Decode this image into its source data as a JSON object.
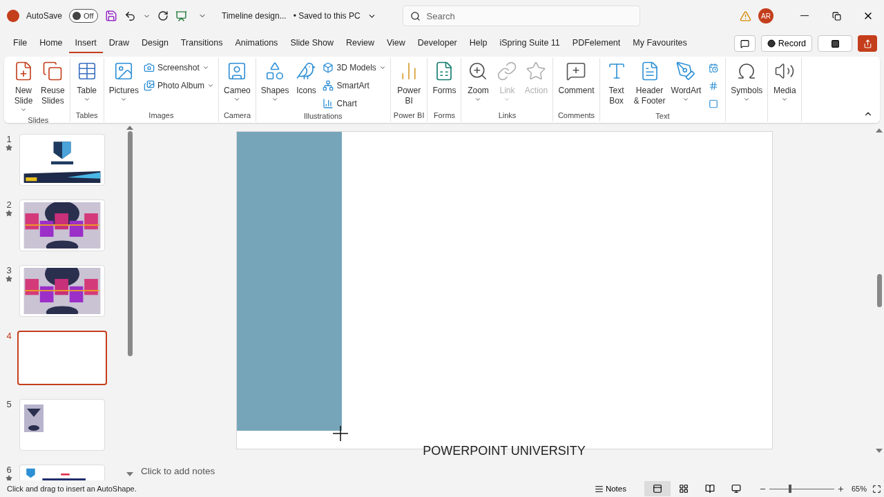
{
  "title_bar": {
    "autosave_label": "AutoSave",
    "autosave": {
      "label": "Off",
      "on": false
    },
    "document_title": "Timeline design...",
    "save_status": "• Saved to this PC",
    "search": {
      "placeholder": "Search"
    },
    "avatar": "AR"
  },
  "menu_tabs": [
    {
      "label": "File",
      "selected": false
    },
    {
      "label": "Home",
      "selected": false
    },
    {
      "label": "Insert",
      "selected": true
    },
    {
      "label": "Draw",
      "selected": false
    },
    {
      "label": "Design",
      "selected": false
    },
    {
      "label": "Transitions",
      "selected": false
    },
    {
      "label": "Animations",
      "selected": false
    },
    {
      "label": "Slide Show",
      "selected": false
    },
    {
      "label": "Review",
      "selected": false
    },
    {
      "label": "View",
      "selected": false
    },
    {
      "label": "Developer",
      "selected": false
    },
    {
      "label": "Help",
      "selected": false
    },
    {
      "label": "iSpring Suite 11",
      "selected": false
    },
    {
      "label": "PDFelement",
      "selected": false
    },
    {
      "label": "My Favourites",
      "selected": false
    }
  ],
  "record_button": "Record",
  "ribbon_groups": [
    {
      "name": "Slides",
      "items": [
        {
          "kind": "large",
          "label": "New\nSlide",
          "dropdown": true,
          "disabled": false
        },
        {
          "kind": "large",
          "label": "Reuse\nSlides",
          "dropdown": false,
          "disabled": false
        }
      ]
    },
    {
      "name": "Tables",
      "items": [
        {
          "kind": "large",
          "label": "Table",
          "dropdown": true,
          "disabled": false
        }
      ]
    },
    {
      "name": "Images",
      "items": [
        {
          "kind": "large",
          "label": "Pictures",
          "dropdown": true,
          "disabled": false
        },
        {
          "kind": "small",
          "label": "Screenshot",
          "dropdown": true,
          "disabled": false
        },
        {
          "kind": "small",
          "label": "Photo Album",
          "dropdown": true,
          "disabled": false
        }
      ]
    },
    {
      "name": "Camera",
      "items": [
        {
          "kind": "large",
          "label": "Cameo",
          "dropdown": true,
          "disabled": false
        }
      ]
    },
    {
      "name": "Illustrations",
      "items": [
        {
          "kind": "large",
          "label": "Shapes",
          "dropdown": true,
          "disabled": false
        },
        {
          "kind": "large",
          "label": "Icons",
          "dropdown": false,
          "disabled": false
        },
        {
          "kind": "small",
          "label": "3D Models",
          "dropdown": true,
          "disabled": false
        },
        {
          "kind": "small",
          "label": "SmartArt",
          "dropdown": false,
          "disabled": false
        },
        {
          "kind": "small",
          "label": "Chart",
          "dropdown": false,
          "disabled": false
        }
      ]
    },
    {
      "name": "Power BI",
      "items": [
        {
          "kind": "large",
          "label": "Power\nBI",
          "dropdown": false,
          "disabled": false
        }
      ]
    },
    {
      "name": "Forms",
      "items": [
        {
          "kind": "large",
          "label": "Forms",
          "dropdown": false,
          "disabled": false
        }
      ]
    },
    {
      "name": "Links",
      "items": [
        {
          "kind": "large",
          "label": "Zoom",
          "dropdown": true,
          "disabled": false
        },
        {
          "kind": "large",
          "label": "Link",
          "dropdown": true,
          "disabled": true
        },
        {
          "kind": "large",
          "label": "Action",
          "dropdown": false,
          "disabled": true
        }
      ]
    },
    {
      "name": "Comments",
      "items": [
        {
          "kind": "large",
          "label": "Comment",
          "dropdown": false,
          "disabled": false
        }
      ]
    },
    {
      "name": "Text",
      "items": [
        {
          "kind": "large",
          "label": "Text\nBox",
          "dropdown": false,
          "disabled": false
        },
        {
          "kind": "large",
          "label": "Header\n& Footer",
          "dropdown": false,
          "disabled": false
        },
        {
          "kind": "large",
          "label": "WordArt",
          "dropdown": true,
          "disabled": false
        },
        {
          "kind": "icon",
          "dropdown": false,
          "disabled": false
        },
        {
          "kind": "icon",
          "dropdown": false,
          "disabled": false
        },
        {
          "kind": "icon",
          "dropdown": false,
          "disabled": false
        }
      ]
    },
    {
      "items": [
        {
          "kind": "large",
          "label": "Symbols",
          "dropdown": true,
          "disabled": false
        }
      ]
    },
    {
      "items": [
        {
          "kind": "large",
          "label": "Media",
          "dropdown": true,
          "disabled": false
        }
      ]
    }
  ],
  "slides": [
    {
      "number": "1",
      "starred": true,
      "selected": false,
      "kind": "picture"
    },
    {
      "number": "2",
      "starred": true,
      "selected": false,
      "kind": "picture"
    },
    {
      "number": "3",
      "starred": true,
      "selected": false,
      "kind": "picture"
    },
    {
      "number": "4",
      "starred": false,
      "selected": true,
      "kind": "blank"
    },
    {
      "number": "5",
      "starred": false,
      "selected": false,
      "kind": "picture"
    },
    {
      "number": "6",
      "starred": true,
      "selected": false,
      "kind": "picture"
    }
  ],
  "slide": {
    "caption": "POWERPOINT UNIVERSITY"
  },
  "notes": {
    "placeholder": "Click to add notes"
  },
  "status_bar": {
    "message": "Click and drag to insert an AutoShape.",
    "notes_button": "Notes",
    "views": [
      {
        "selected": true
      },
      {
        "selected": false
      },
      {
        "selected": false
      },
      {
        "selected": false
      }
    ],
    "zoom": {
      "level": 0.32
    },
    "zoom_reading": "65%"
  }
}
